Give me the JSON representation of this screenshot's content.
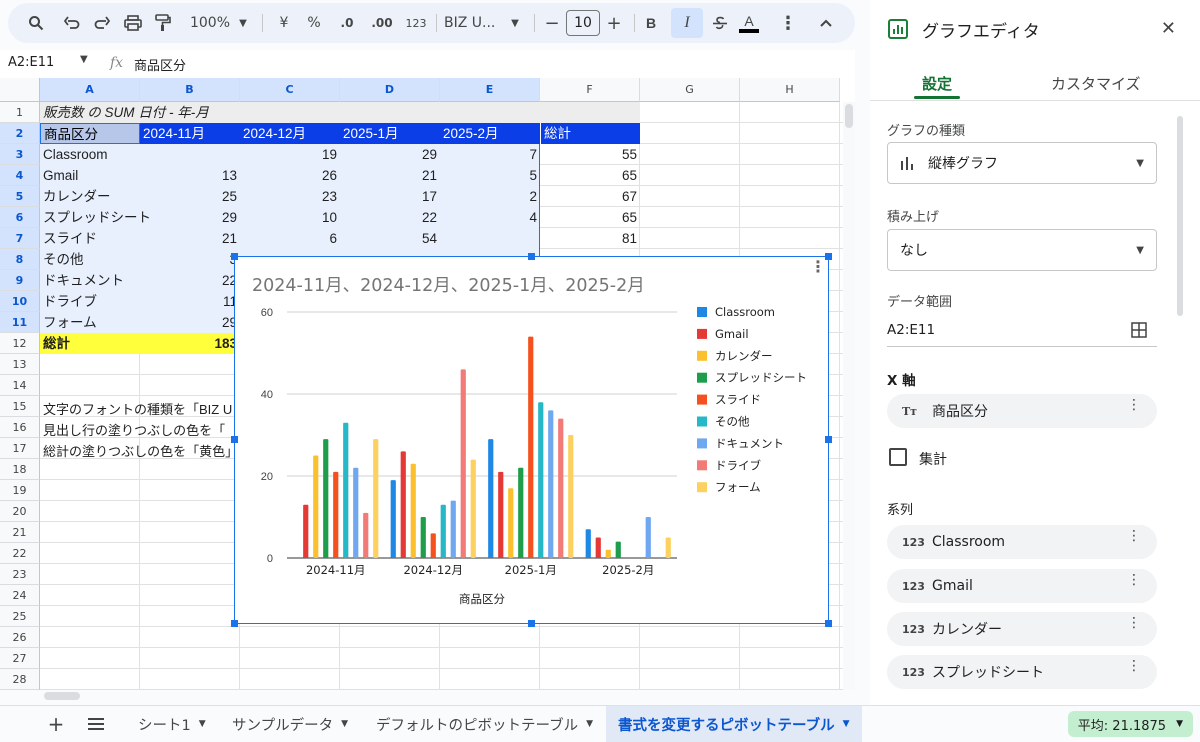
{
  "toolbar": {
    "zoom": "100%",
    "currency": "¥",
    "percent": "%",
    "dec_less": ".0",
    "dec_more": ".00",
    "number_format": "123",
    "font": "BIZ U...",
    "font_size": "10",
    "bold": "B",
    "italic": "I",
    "text_color": "A"
  },
  "formula_bar": {
    "name_box": "A2:E11",
    "fx": "fx",
    "content": "商品区分"
  },
  "grid": {
    "columns": [
      "A",
      "B",
      "C",
      "D",
      "E",
      "F",
      "G",
      "H"
    ],
    "rows": [
      "1",
      "2",
      "3",
      "4",
      "5",
      "6",
      "7",
      "8",
      "9",
      "10",
      "11",
      "12",
      "13",
      "14",
      "15",
      "16",
      "17",
      "18",
      "19",
      "20",
      "21",
      "22",
      "23",
      "24",
      "25",
      "26",
      "27",
      "28"
    ],
    "pivot_title": "販売数 の SUM 日付 - 年-月",
    "header": [
      "商品区分",
      "2024-11月",
      "2024-12月",
      "2025-1月",
      "2025-2月",
      "総計"
    ],
    "body": [
      [
        "Classroom",
        "",
        "19",
        "29",
        "7",
        "55"
      ],
      [
        "Gmail",
        "13",
        "26",
        "21",
        "5",
        "65"
      ],
      [
        "カレンダー",
        "25",
        "23",
        "17",
        "2",
        "67"
      ],
      [
        "スプレッドシート",
        "29",
        "10",
        "22",
        "4",
        "65"
      ],
      [
        "スライド",
        "21",
        "6",
        "54",
        "",
        "81"
      ],
      [
        "その他",
        "3",
        "",
        "",
        "",
        ""
      ],
      [
        "ドキュメント",
        "22",
        "",
        "",
        "",
        ""
      ],
      [
        "ドライブ",
        "11",
        "",
        "",
        "",
        ""
      ],
      [
        "フォーム",
        "29",
        "",
        "",
        "",
        ""
      ]
    ],
    "total": [
      "総計",
      "183"
    ],
    "notes": [
      "文字のフォントの種類を「BIZ U",
      "見出し行の塗りつぶしの色を「",
      "総計の塗りつぶしの色を「黄色」"
    ]
  },
  "chart_data": {
    "type": "bar",
    "title": "2024-11月、2024-12月、2025-1月、2025-2月",
    "xlabel": "商品区分",
    "ylabel": "",
    "ylim": [
      0,
      60
    ],
    "yticks": [
      "0",
      "20",
      "40",
      "60"
    ],
    "categories": [
      "2024-11月",
      "2024-12月",
      "2025-1月",
      "2025-2月"
    ],
    "legend_position": "right",
    "series": [
      {
        "name": "Classroom",
        "color": "#1e88e5",
        "values": [
          0,
          19,
          29,
          7
        ]
      },
      {
        "name": "Gmail",
        "color": "#e53935",
        "values": [
          13,
          26,
          21,
          5
        ]
      },
      {
        "name": "カレンダー",
        "color": "#fbc02d",
        "values": [
          25,
          23,
          17,
          2
        ]
      },
      {
        "name": "スプレッドシート",
        "color": "#1e9e4a",
        "values": [
          29,
          10,
          22,
          4
        ]
      },
      {
        "name": "スライド",
        "color": "#f4511e",
        "values": [
          21,
          6,
          54,
          0
        ]
      },
      {
        "name": "その他",
        "color": "#26b8c6",
        "values": [
          33,
          13,
          38,
          0
        ]
      },
      {
        "name": "ドキュメント",
        "color": "#6fa8f0",
        "values": [
          22,
          14,
          36,
          10
        ]
      },
      {
        "name": "ドライブ",
        "color": "#f27b78",
        "values": [
          11,
          46,
          34,
          0
        ]
      },
      {
        "name": "フォーム",
        "color": "#fdd160",
        "values": [
          29,
          24,
          30,
          5
        ]
      }
    ]
  },
  "tabs": {
    "sheets": [
      "シート1",
      "サンプルデータ",
      "デフォルトのピボットテーブル",
      "書式を変更するピボットテーブル"
    ],
    "average": "平均: 21.1875"
  },
  "editor": {
    "title": "グラフエディタ",
    "tab_setup": "設定",
    "tab_customize": "カスタマイズ",
    "chart_type_label": "グラフの種類",
    "chart_type": "縦棒グラフ",
    "stacking_label": "積み上げ",
    "stacking": "なし",
    "range_label": "データ範囲",
    "range": "A2:E11",
    "x_axis_label": "X 軸",
    "x_axis": "商品区分",
    "aggregate": "集計",
    "series_label": "系列",
    "series": [
      "Classroom",
      "Gmail",
      "カレンダー",
      "スプレッドシート"
    ],
    "chip_text_icon": "Tт",
    "chip_num_icon": "123"
  },
  "colors": {
    "accent": "#1a73e8",
    "header_fill": "#0b3ee6",
    "total_fill": "#ffff3b",
    "green": "#137333"
  }
}
